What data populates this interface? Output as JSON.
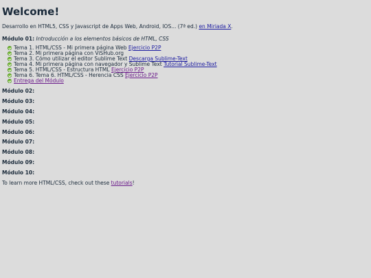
{
  "title": "Welcome!",
  "intro": {
    "text": "Desarrollo en HTML5, CSS y Javascript de Apps Web, Android, IOS... (7ª ed.) ",
    "link": "en Miriada X",
    "end": "."
  },
  "module1": {
    "label": "Módulo 01:",
    "desc": "Introducción a los elementos básicos de HTML, CSS",
    "topics": [
      {
        "text": "Tema 1. HTML/CSS - Mi primera página Web ",
        "link": "Ejercicio P2P"
      },
      {
        "text": "Tema 2. Mi primera página con ViSHub.org",
        "link": ""
      },
      {
        "text": "Tema 3. Cómo utilizar el editor Sublime Text ",
        "link": "Descarga Sublime-Text"
      },
      {
        "text": "Tema 4. Mi primera página con navegador y Sublime Text ",
        "link": "Tutorial Sublime-Text"
      },
      {
        "text": "Tema 5. HTML/CSS - Estructura HTML ",
        "link": "Ejercicio P2P"
      },
      {
        "text": "Tema 6. Tema 6. HTML/CSS - Herencia CSS ",
        "link": "Ejercicio P2P"
      },
      {
        "text": "",
        "link": "Entrega del Módulo"
      }
    ]
  },
  "modules": [
    "Módulo 02:",
    "Módulo 03:",
    "Módulo 04:",
    "Módulo 05:",
    "Módulo 06:",
    "Módulo 07:",
    "Módulo 08:",
    "Módulo 09:",
    "Módulo 10:"
  ],
  "footer": {
    "text": "To learn more HTML/CSS, check out these ",
    "link": "tutorials",
    "end": "!"
  },
  "colors": {
    "background": "#dcdcdc",
    "link": "#1a1aa0",
    "visited_link": "#6a1a8a",
    "bullet": "#7cc13a"
  }
}
